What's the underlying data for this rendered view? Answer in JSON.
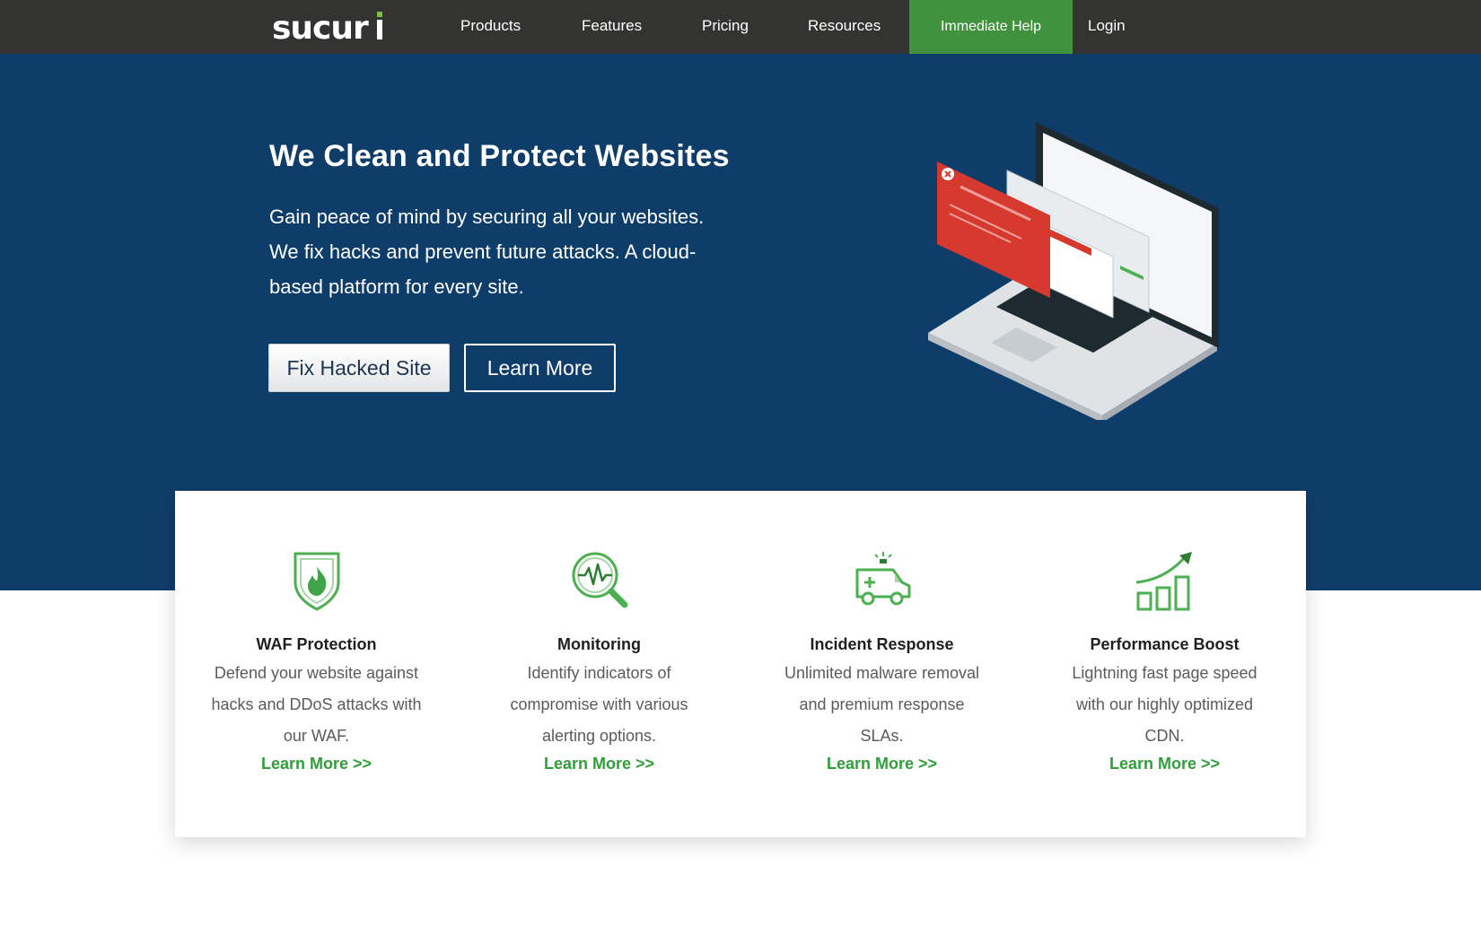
{
  "nav": {
    "logo_text": "sucuri",
    "items": [
      "Products",
      "Features",
      "Pricing",
      "Resources"
    ],
    "cta_label": "Immediate Help",
    "login_label": "Login"
  },
  "hero": {
    "title": "We Clean and Protect Websites",
    "description": "Gain peace of mind by securing all your websites. We fix hacks and prevent future attacks. A cloud-based platform for every site.",
    "primary_button": "Fix Hacked Site",
    "secondary_button": "Learn More"
  },
  "features": [
    {
      "icon": "shield-fire-icon",
      "title": "WAF Protection",
      "description": "Defend your website against hacks and DDoS attacks with our WAF.",
      "link": "Learn More >>"
    },
    {
      "icon": "magnifier-pulse-icon",
      "title": "Monitoring",
      "description": "Identify indicators of compromise with various alerting options.",
      "link": "Learn More >>"
    },
    {
      "icon": "ambulance-icon",
      "title": "Incident Response",
      "description": "Unlimited malware removal and premium response SLAs.",
      "link": "Learn More >>"
    },
    {
      "icon": "growth-chart-icon",
      "title": "Performance Boost",
      "description": "Lightning fast page speed with our highly optimized CDN.",
      "link": "Learn More >>"
    }
  ],
  "colors": {
    "nav_bg": "#333432",
    "hero_bg": "#0f3d6a",
    "accent_green": "#40923e",
    "link_green": "#2f9e3b",
    "icon_green": "#4caf50",
    "warning_red": "#d63a2f"
  }
}
